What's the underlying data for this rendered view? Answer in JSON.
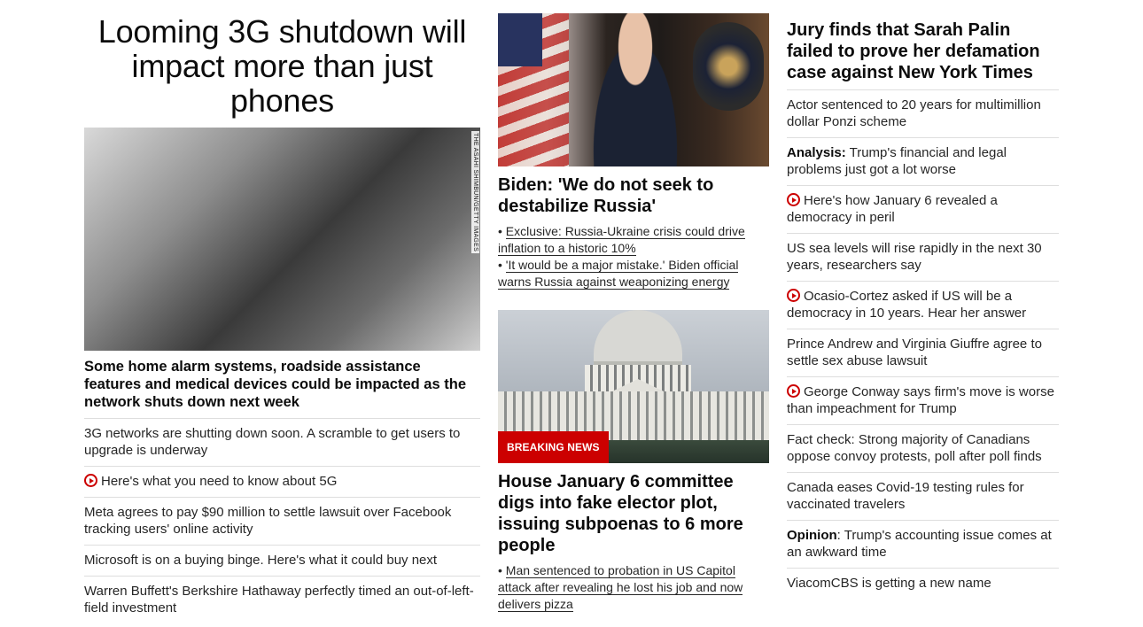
{
  "left": {
    "headline": "Looming 3G shutdown will impact more than just phones",
    "photo_credit": "THE ASAHI SHIMBUN/GETTY IMAGES",
    "caption": "Some home alarm systems, roadside assistance features and medical devices could be impacted as the network shuts down next week",
    "items": [
      {
        "text": "3G networks are shutting down soon. A scramble to get users to upgrade is underway",
        "video": false
      },
      {
        "text": "Here's what you need to know about 5G",
        "video": true
      },
      {
        "text": "Meta agrees to pay $90 million to settle lawsuit over Facebook tracking users' online activity",
        "video": false
      },
      {
        "text": "Microsoft is on a buying binge. Here's what it could buy next",
        "video": false
      },
      {
        "text": "Warren Buffett's Berkshire Hathaway perfectly timed an out-of-left-field investment",
        "video": false
      }
    ]
  },
  "middle": {
    "story1": {
      "headline": "Biden: 'We do not seek to destabilize Russia'",
      "bullets": [
        "Exclusive: Russia-Ukraine crisis could drive inflation to a historic 10%",
        "'It would be a major mistake.' Biden official warns Russia against weaponizing energy"
      ]
    },
    "story2": {
      "badge": "BREAKING NEWS",
      "headline": "House January 6 committee digs into fake elector plot, issuing subpoenas to 6 more people",
      "bullets": [
        "Man sentenced to probation in US Capitol attack after revealing he lost his job and now delivers pizza"
      ]
    },
    "bullet_symbol": "•"
  },
  "right": {
    "headline": "Jury finds that Sarah Palin failed to prove her defamation case against New York Times",
    "items": [
      {
        "prefix": "",
        "text": "Actor sentenced to 20 years for multimillion dollar Ponzi scheme",
        "video": false
      },
      {
        "prefix": "Analysis:",
        "text": " Trump's financial and legal problems just got a lot worse",
        "video": false
      },
      {
        "prefix": "",
        "text": "Here's how January 6 revealed a democracy in peril",
        "video": true
      },
      {
        "prefix": "",
        "text": "US sea levels will rise rapidly in the next 30 years, researchers say",
        "video": false
      },
      {
        "prefix": "",
        "text": "Ocasio-Cortez asked if US will be a democracy in 10 years. Hear her answer",
        "video": true
      },
      {
        "prefix": "",
        "text": "Prince Andrew and Virginia Giuffre agree to settle sex abuse lawsuit",
        "video": false
      },
      {
        "prefix": "",
        "text": "George Conway says firm's move is worse than impeachment for Trump",
        "video": true
      },
      {
        "prefix": "",
        "text": "Fact check: Strong majority of Canadians oppose convoy protests, poll after poll finds",
        "video": false
      },
      {
        "prefix": "",
        "text": "Canada eases Covid-19 testing rules for vaccinated travelers",
        "video": false
      },
      {
        "prefix": "Opinion",
        "text": ": Trump's accounting issue comes at an awkward time",
        "video": false
      },
      {
        "prefix": "",
        "text": "ViacomCBS is getting a new name",
        "video": false
      }
    ]
  },
  "colors": {
    "accent": "#cc0000",
    "divider": "#dedede",
    "text": "#262626"
  },
  "icons": {
    "video": "play-circle-icon"
  }
}
